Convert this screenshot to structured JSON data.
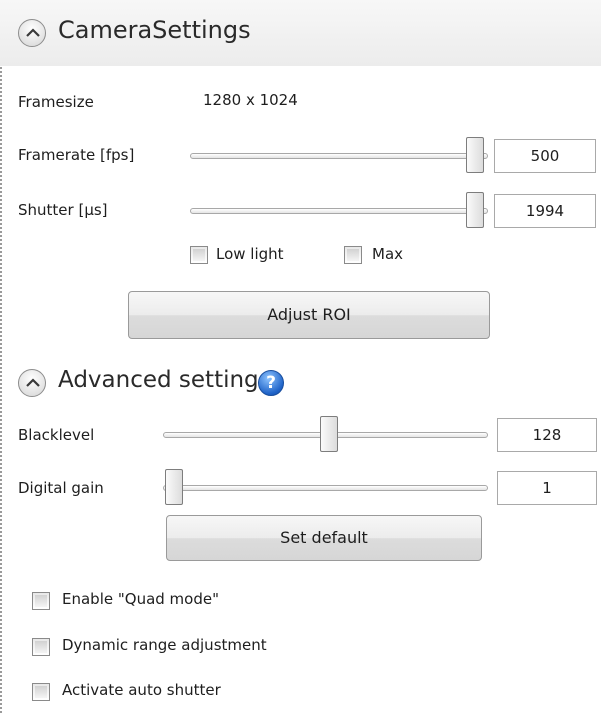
{
  "camera_settings": {
    "title": "CameraSettings",
    "framesize": {
      "label": "Framesize",
      "value": "1280 x 1024"
    },
    "framerate": {
      "label": "Framerate [fps]",
      "value": "500",
      "slider_fraction": 1.0
    },
    "shutter": {
      "label": "Shutter [µs]",
      "value": "1994",
      "slider_fraction": 1.0
    },
    "low_light": {
      "label": "Low light",
      "checked": false
    },
    "max": {
      "label": "Max",
      "checked": false
    },
    "adjust_roi_label": "Adjust ROI"
  },
  "advanced_settings": {
    "title": "Advanced settings",
    "help_glyph": "?",
    "blacklevel": {
      "label": "Blacklevel",
      "value": "128",
      "slider_fraction": 0.5
    },
    "digital_gain": {
      "label": "Digital gain",
      "value": "1",
      "slider_fraction": 0.0
    },
    "set_default_label": "Set default",
    "quad_mode": {
      "label": "Enable \"Quad mode\"",
      "checked": false
    },
    "dynamic_range": {
      "label": "Dynamic range adjustment",
      "checked": false
    },
    "auto_shutter": {
      "label": "Activate auto shutter",
      "checked": false
    }
  },
  "icons": {
    "collapse": "chevron-up-icon",
    "help": "help-icon"
  },
  "colors": {
    "help_icon_blue": "#1f63c8",
    "header_bg": "#f0f0f0"
  }
}
